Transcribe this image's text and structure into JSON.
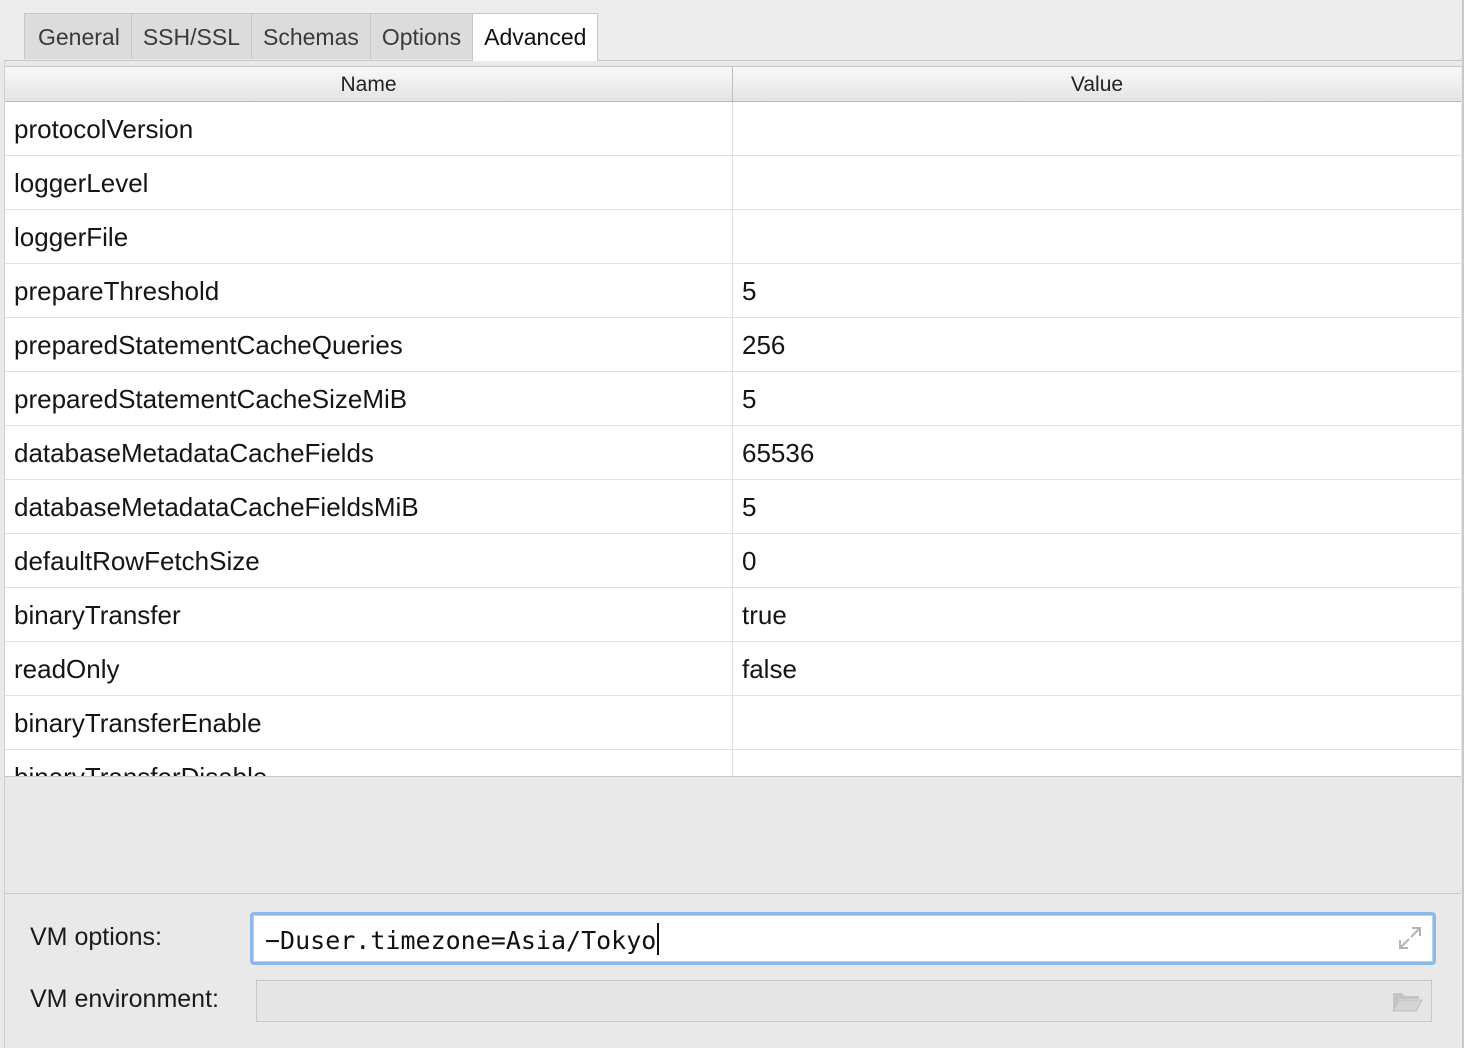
{
  "tabs": [
    {
      "label": "General"
    },
    {
      "label": "SSH/SSL"
    },
    {
      "label": "Schemas"
    },
    {
      "label": "Options"
    },
    {
      "label": "Advanced",
      "active": true
    }
  ],
  "table": {
    "headers": {
      "name": "Name",
      "value": "Value"
    },
    "rows": [
      {
        "name": "protocolVersion",
        "value": ""
      },
      {
        "name": "loggerLevel",
        "value": ""
      },
      {
        "name": "loggerFile",
        "value": ""
      },
      {
        "name": "prepareThreshold",
        "value": "5"
      },
      {
        "name": "preparedStatementCacheQueries",
        "value": "256"
      },
      {
        "name": "preparedStatementCacheSizeMiB",
        "value": "5"
      },
      {
        "name": "databaseMetadataCacheFields",
        "value": "65536"
      },
      {
        "name": "databaseMetadataCacheFieldsMiB",
        "value": "5"
      },
      {
        "name": "defaultRowFetchSize",
        "value": "0"
      },
      {
        "name": "binaryTransfer",
        "value": "true"
      },
      {
        "name": "readOnly",
        "value": "false"
      },
      {
        "name": "binaryTransferEnable",
        "value": ""
      },
      {
        "name": "binaryTransferDisable",
        "value": ""
      }
    ]
  },
  "vm": {
    "options_label": "VM options:",
    "options_value": "−Duser.timezone=Asia/Tokyo",
    "environment_label": "VM environment:",
    "environment_value": ""
  },
  "icons": {
    "expand": "expand-icon",
    "folder": "folder-icon"
  },
  "colors": {
    "focus_border": "#8db8ec"
  }
}
